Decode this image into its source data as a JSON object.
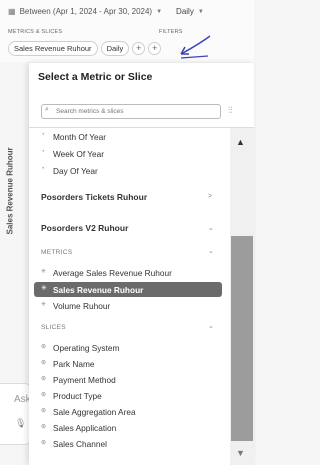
{
  "header": {
    "date_range_label": "Between (Apr 1, 2024 - Apr 30, 2024)",
    "granularity_label": "Daily",
    "metrics_slices_label": "METRICS & SLICES",
    "filters_label": "FILTERS",
    "chips": [
      "Sales Revenue Ruhour",
      "Daily"
    ],
    "plus_label": "+"
  },
  "chart": {
    "y_axis_label": "Sales Revenue Ruhour"
  },
  "ask": {
    "text": "Ask"
  },
  "panel": {
    "title": "Select a Metric or Slice",
    "search_placeholder": "Search metrics & slices",
    "date_items": [
      "Month Of Year",
      "Week Of Year",
      "Day Of Year"
    ],
    "groups": [
      "Posorders Tickets Ruhour",
      "Posorders V2 Ruhour"
    ],
    "metrics_header": "METRICS",
    "metrics": [
      "Average Sales Revenue Ruhour",
      "Sales Revenue Ruhour",
      "Volume Ruhour"
    ],
    "slices_header": "SLICES",
    "slices": [
      "Operating System",
      "Park Name",
      "Payment Method",
      "Product Type",
      "Sale Aggregation Area",
      "Sales Application",
      "Sales Channel"
    ]
  },
  "colors": {
    "selected_bg": "#6b6b6b",
    "annotation_arrow": "#3b44b8",
    "scroll_thumb": "#9c9c9c"
  }
}
